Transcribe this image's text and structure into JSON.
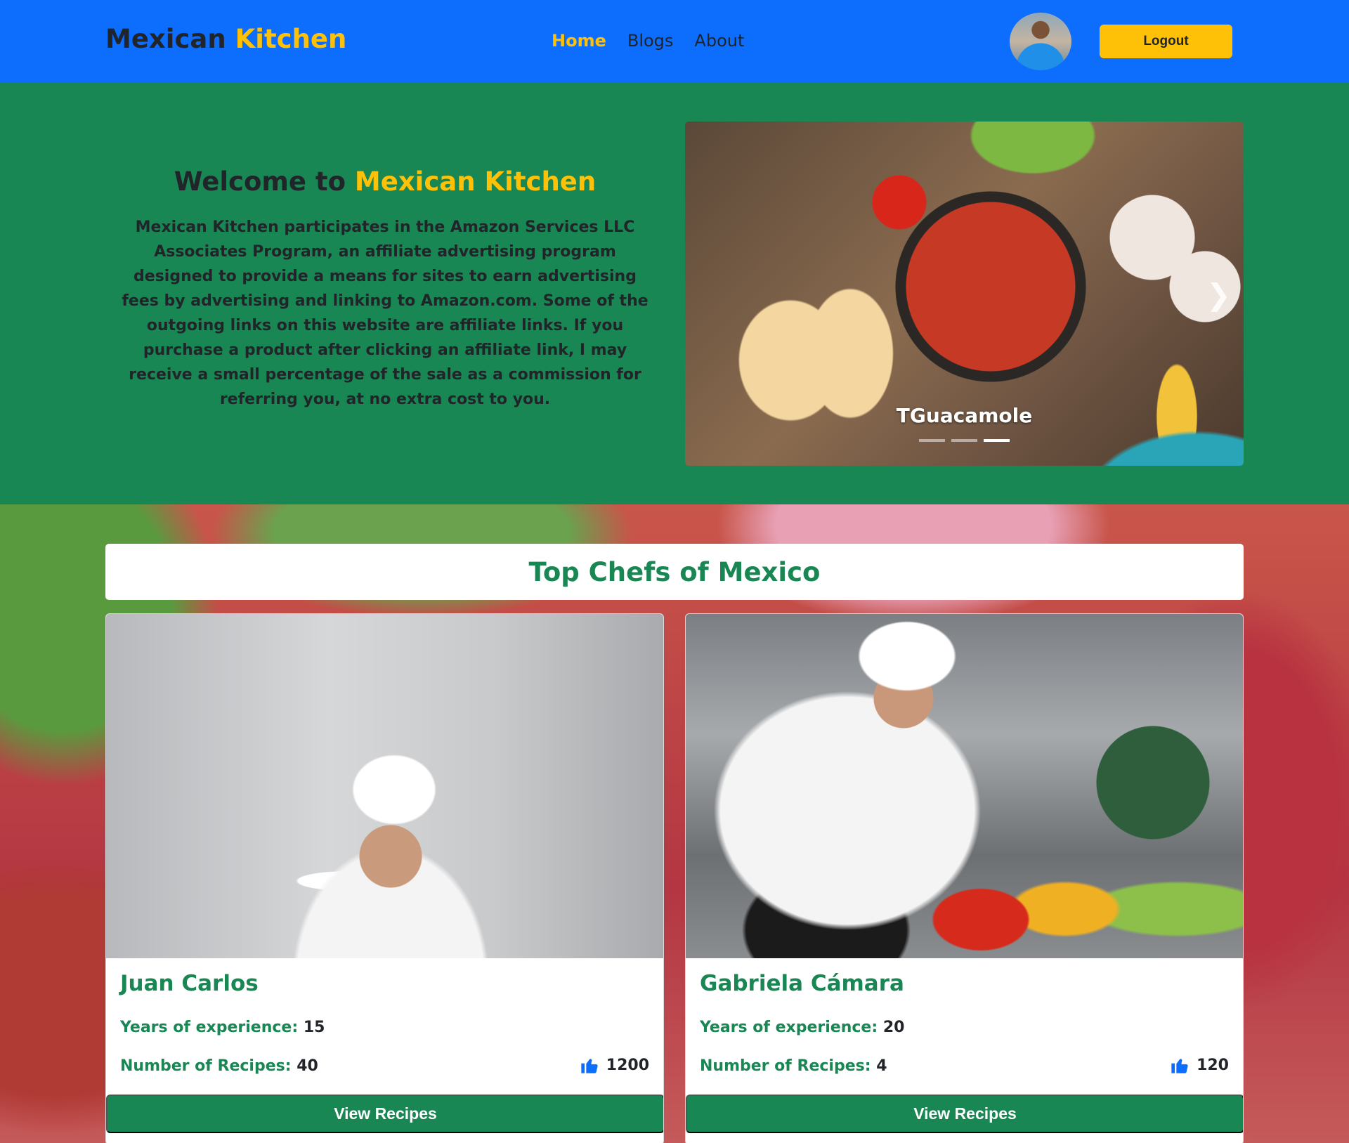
{
  "navbar": {
    "brand_part1": "Mexican",
    "brand_part2": "Kitchen",
    "links": [
      {
        "label": "Home",
        "active": true
      },
      {
        "label": "Blogs",
        "active": false
      },
      {
        "label": "About",
        "active": false
      }
    ],
    "logout_label": "Logout"
  },
  "hero": {
    "title_prefix": "Welcome to",
    "title_accent": "Mexican Kitchen",
    "description": "Mexican Kitchen participates in the Amazon Services LLC Associates Program, an affiliate advertising program designed to provide a means for sites to earn advertising fees by advertising and linking to Amazon.com. Some of the outgoing links on this website are affiliate links. If you purchase a product after clicking an affiliate link, I may receive a small percentage of the sale as a commission for referring you, at no extra cost to you.",
    "carousel": {
      "caption": "TGuacamole",
      "slide_count": 3,
      "active_slide": 3
    }
  },
  "chefs": {
    "section_title": "Top Chefs of Mexico",
    "experience_label": "Years of experience:",
    "recipes_label": "Number of Recipes:",
    "button_label": "View Recipes",
    "items": [
      {
        "name": "Juan Carlos",
        "experience": "15",
        "recipes": "40",
        "likes": "1200"
      },
      {
        "name": "Gabriela Cámara",
        "experience": "20",
        "recipes": "4",
        "likes": "120"
      }
    ]
  },
  "colors": {
    "navbar": "#0d6efd",
    "accent": "#ffc107",
    "green": "#198754",
    "dark_text": "#212529",
    "like_icon": "#0d6efd"
  },
  "icons": {
    "carousel_next": "chevron-right-icon",
    "like": "thumbs-up-icon"
  }
}
